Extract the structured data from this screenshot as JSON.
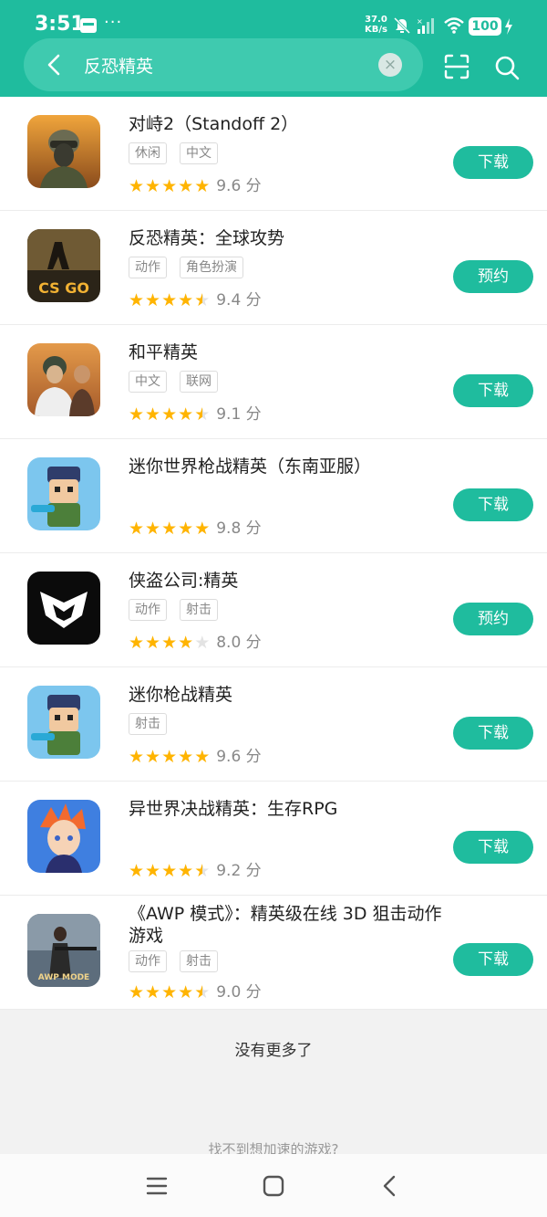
{
  "status_bar": {
    "time": "3:51",
    "dots": "···",
    "net_speed_value": "37.0",
    "net_speed_unit": "KB/s",
    "battery": "100"
  },
  "search": {
    "query": "反恐精英",
    "clear_symbol": "×"
  },
  "icons": {
    "back": "back-arrow-icon",
    "clear": "clear-icon",
    "scan": "scan-icon",
    "search": "search-icon"
  },
  "colors": {
    "accent": "#1fbc9e",
    "star": "#ffb400"
  },
  "results": [
    {
      "name": "对峙2（Standoff 2）",
      "tags": [
        "休闲",
        "中文"
      ],
      "stars": 5,
      "score": "9.6 分",
      "action": "下载"
    },
    {
      "name": "反恐精英：全球攻势",
      "tags": [
        "动作",
        "角色扮演"
      ],
      "stars": 4.5,
      "score": "9.4 分",
      "action": "预约"
    },
    {
      "name": "和平精英",
      "tags": [
        "中文",
        "联网"
      ],
      "stars": 4.5,
      "score": "9.1 分",
      "action": "下载"
    },
    {
      "name": "迷你世界枪战精英（东南亚服）",
      "tags": [],
      "stars": 5,
      "score": "9.8 分",
      "action": "下载"
    },
    {
      "name": "侠盗公司:精英",
      "tags": [
        "动作",
        "射击"
      ],
      "stars": 4,
      "score": "8.0 分",
      "action": "预约"
    },
    {
      "name": "迷你枪战精英",
      "tags": [
        "射击"
      ],
      "stars": 5,
      "score": "9.6 分",
      "action": "下载"
    },
    {
      "name": "异世界决战精英：生存RPG",
      "tags": [],
      "stars": 4.5,
      "score": "9.2 分",
      "action": "下载"
    },
    {
      "name": "《AWP 模式》：精英级在线 3D 狙击动作游戏",
      "tags": [
        "动作",
        "射击"
      ],
      "stars": 4.5,
      "score": "9.0 分",
      "action": "下载"
    }
  ],
  "footer": {
    "end_text": "没有更多了",
    "hint_text": "找不到想加速的游戏?"
  },
  "icon_texts": {
    "csgo_logo": "CS GO",
    "awp_logo": "AWP MODE"
  }
}
